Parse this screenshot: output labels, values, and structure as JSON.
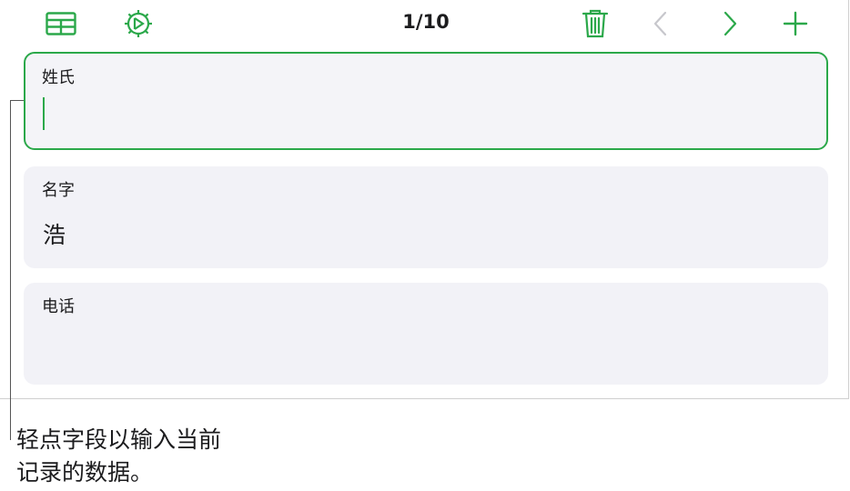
{
  "toolbar": {
    "icons": {
      "table": "table-icon",
      "format": "format-icon",
      "trash": "trash-icon",
      "previous": "chevron-left-icon",
      "next": "chevron-right-icon",
      "add": "plus-icon"
    },
    "record_counter": "1/10",
    "previous_enabled": false,
    "accent_color": "#2ba84a"
  },
  "fields": [
    {
      "label": "姓氏",
      "value": "",
      "active": true
    },
    {
      "label": "名字",
      "value": "浩",
      "active": false
    },
    {
      "label": "电话",
      "value": "",
      "active": false
    }
  ],
  "callout": {
    "line1": "轻点字段以输入当前",
    "line2": "记录的数据。"
  }
}
